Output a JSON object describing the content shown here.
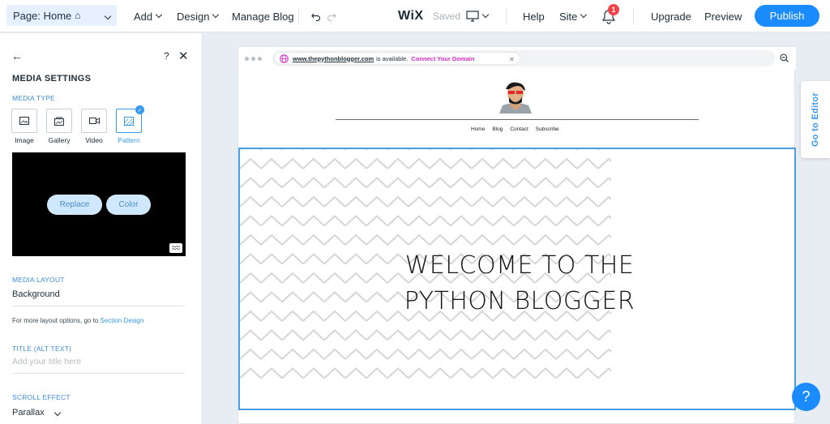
{
  "topbar": {
    "page_select": "Page: Home",
    "menu": [
      "Add",
      "Design",
      "Manage Blog"
    ],
    "logo": "WiX",
    "saved": "Saved",
    "help": "Help",
    "site": "Site",
    "notifications_count": "1",
    "upgrade": "Upgrade",
    "preview": "Preview",
    "publish": "Publish"
  },
  "panel": {
    "title": "MEDIA SETTINGS",
    "help": "?",
    "media_type_label": "MEDIA TYPE",
    "media_types": [
      "Image",
      "Gallery",
      "Video",
      "Pattern"
    ],
    "selected_media_type": "Pattern",
    "replace": "Replace",
    "color": "Color",
    "media_layout_label": "MEDIA LAYOUT",
    "media_layout_value": "Background",
    "layout_hint_prefix": "For more layout options, go to",
    "layout_hint_link": "Section Design",
    "title_label": "TITLE (ALT TEXT)",
    "title_placeholder": "Add your title here",
    "scroll_label": "SCROLL EFFECT",
    "scroll_value": "Parallax"
  },
  "site": {
    "domain": "www.thepythonblogger.com",
    "availability": "is available.",
    "connect": "Connect Your Domain",
    "nav": [
      "Home",
      "Blog",
      "Contact",
      "Subscribe"
    ],
    "heading_line1": "WELCOME TO THE",
    "heading_line2": "PYTHON BLOGGER"
  },
  "go_to_editor": "Go to Editor",
  "help_fab": "?",
  "colors": {
    "accent": "#1a8cff",
    "link": "#3899ec",
    "badge": "#f04248",
    "connect": "#d62cc8"
  }
}
